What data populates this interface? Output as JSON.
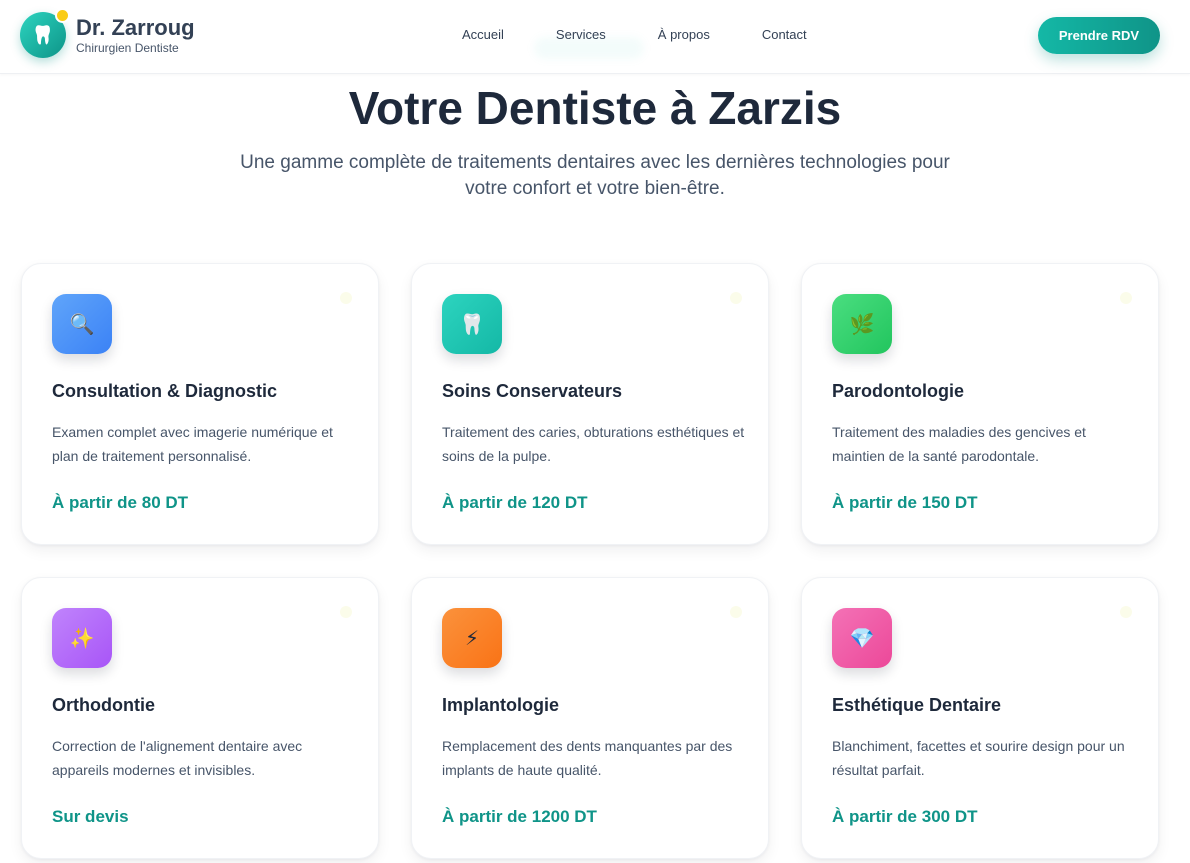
{
  "header": {
    "name": "Dr. Zarroug",
    "subtitle": "Chirurgien Dentiste",
    "logo_icon": "🦷",
    "nav": [
      "Accueil",
      "Services",
      "À propos",
      "Contact"
    ],
    "cta_label": "Prendre RDV"
  },
  "hero": {
    "title": "Votre Dentiste à Zarzis",
    "subtitle": "Une gamme complète de traitements dentaires avec les dernières technologies pour votre confort et votre bien-être."
  },
  "services": [
    {
      "icon": "🔍",
      "icon_name": "magnifier-icon",
      "color_from": "#60a5fa",
      "color_to": "#3b82f6",
      "title": "Consultation & Diagnostic",
      "desc": "Examen complet avec imagerie numérique et plan de traitement personnalisé.",
      "price": "À partir de 80 DT"
    },
    {
      "icon": "🦷",
      "icon_name": "tooth-icon",
      "color_from": "#2dd4bf",
      "color_to": "#14b8a6",
      "title": "Soins Conservateurs",
      "desc": "Traitement des caries, obturations esthétiques et soins de la pulpe.",
      "price": "À partir de 120 DT"
    },
    {
      "icon": "🌿",
      "icon_name": "leaf-icon",
      "color_from": "#4ade80",
      "color_to": "#22c55e",
      "title": "Parodontologie",
      "desc": "Traitement des maladies des gencives et maintien de la santé parodontale.",
      "price": "À partir de 150 DT"
    },
    {
      "icon": "✨",
      "icon_name": "sparkles-icon",
      "color_from": "#c084fc",
      "color_to": "#a855f7",
      "title": "Orthodontie",
      "desc": "Correction de l'alignement dentaire avec appareils modernes et invisibles.",
      "price": "Sur devis"
    },
    {
      "icon": "⚡",
      "icon_name": "lightning-icon",
      "color_from": "#fb923c",
      "color_to": "#f97316",
      "title": "Implantologie",
      "desc": "Remplacement des dents manquantes par des implants de haute qualité.",
      "price": "À partir de 1200 DT"
    },
    {
      "icon": "💎",
      "icon_name": "gem-icon",
      "color_from": "#f472b6",
      "color_to": "#ec4899",
      "title": "Esthétique Dentaire",
      "desc": "Blanchiment, facettes et sourire design pour un résultat parfait.",
      "price": "À partir de 300 DT"
    }
  ]
}
